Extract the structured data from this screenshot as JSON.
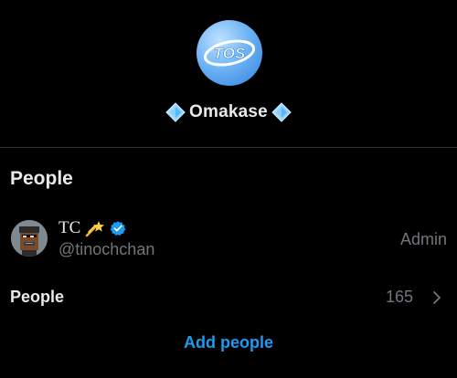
{
  "group": {
    "avatar_text": "TOS",
    "name": "Omakase",
    "name_icons": [
      "sparkle-diamond-icon",
      "sparkle-diamond-icon"
    ]
  },
  "people_section": {
    "title": "People",
    "members": [
      {
        "name": "TC",
        "name_emoji": "dizzy-comet-icon",
        "verified": true,
        "handle": "@tinochchan",
        "role": "Admin"
      }
    ],
    "people_row": {
      "label": "People",
      "count": "165"
    },
    "add_people_label": "Add people"
  },
  "colors": {
    "background": "#000000",
    "primary_text": "#e7e9ea",
    "secondary_text": "#71767b",
    "accent": "#1d9bf0",
    "divider": "#2f3336"
  }
}
